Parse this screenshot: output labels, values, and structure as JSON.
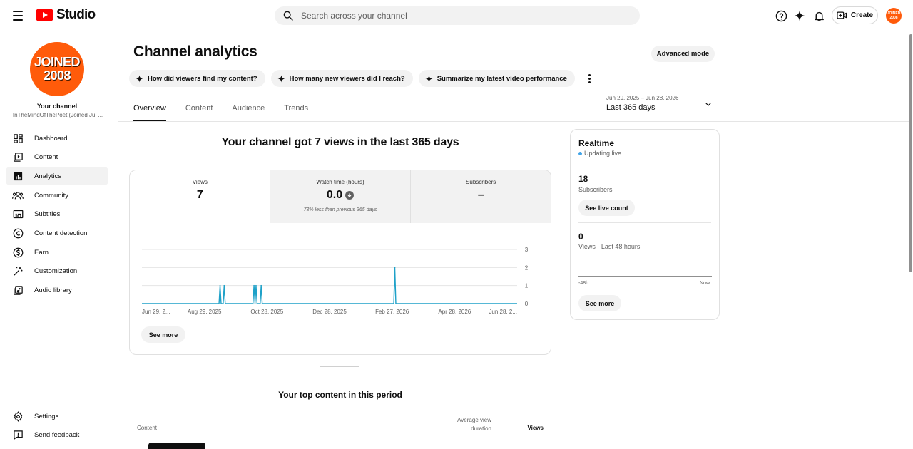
{
  "app": {
    "logo_text": "Studio",
    "search_placeholder": "Search across your channel",
    "create_label": "Create",
    "avatar_text_line1": "JOINED",
    "avatar_text_line2": "2008"
  },
  "sidebar": {
    "avatar_line1": "JOINED",
    "avatar_line2": "2008",
    "your_channel": "Your channel",
    "channel_name": "InTheMindOfThePoet (Joined Jul ...",
    "items": [
      {
        "label": "Dashboard",
        "icon": "dashboard-icon"
      },
      {
        "label": "Content",
        "icon": "content-icon"
      },
      {
        "label": "Analytics",
        "icon": "analytics-icon",
        "active": true
      },
      {
        "label": "Community",
        "icon": "community-icon"
      },
      {
        "label": "Subtitles",
        "icon": "subtitles-icon"
      },
      {
        "label": "Content detection",
        "icon": "copyright-icon"
      },
      {
        "label": "Earn",
        "icon": "dollar-icon"
      },
      {
        "label": "Customization",
        "icon": "magic-wand-icon"
      },
      {
        "label": "Audio library",
        "icon": "audio-library-icon"
      }
    ],
    "bottom_items": [
      {
        "label": "Settings",
        "icon": "gear-icon"
      },
      {
        "label": "Send feedback",
        "icon": "feedback-icon"
      }
    ]
  },
  "main": {
    "title": "Channel analytics",
    "advanced_mode": "Advanced mode",
    "chips": [
      "How did viewers find my content?",
      "How many new viewers did I reach?",
      "Summarize my latest video performance"
    ],
    "tabs": [
      "Overview",
      "Content",
      "Audience",
      "Trends"
    ],
    "active_tab": "Overview",
    "date_range": {
      "sub": "Jun 29, 2025 – Jun 28, 2026",
      "main": "Last 365 days"
    },
    "headline": "Your channel got 7 views in the last 365 days",
    "metrics": [
      {
        "label": "Views",
        "value": "7",
        "note": ""
      },
      {
        "label": "Watch time (hours)",
        "value": "0.0",
        "note": "73% less than previous 365 days"
      },
      {
        "label": "Subscribers",
        "value": "–",
        "note": ""
      }
    ],
    "see_more": "See more",
    "top_content": {
      "title": "Your top content in this period",
      "col_content": "Content",
      "col_avg_line1": "Average view",
      "col_avg_line2": "duration",
      "col_views": "Views"
    }
  },
  "chart_data": {
    "type": "line",
    "title": "",
    "xlabel": "",
    "ylabel": "",
    "ylim": [
      0,
      3
    ],
    "y_ticks": [
      "0",
      "1",
      "2",
      "3"
    ],
    "x_tick_labels": [
      "Jun 29, 2...",
      "Aug 29, 2025",
      "Oct 28, 2025",
      "Dec 28, 2025",
      "Feb 27, 2026",
      "Apr 28, 2026",
      "Jun 28, 2..."
    ],
    "x_range_days": [
      0,
      365
    ],
    "series": [
      {
        "color": "#1ea1c8",
        "points": [
          [
            76,
            1
          ],
          [
            80,
            1
          ],
          [
            109,
            1
          ],
          [
            111,
            1
          ],
          [
            116,
            1
          ],
          [
            246,
            2
          ]
        ]
      }
    ],
    "grid": true,
    "legend": "none"
  },
  "realtime": {
    "title": "Realtime",
    "status": "Updating live",
    "subscribers_value": "18",
    "subscribers_label": "Subscribers",
    "see_live_count": "See live count",
    "views_value": "0",
    "views_label": "Views · Last 48 hours",
    "axis_left": "-48h",
    "axis_right": "Now",
    "see_more": "See more",
    "live_dot_color": "#41a4e8"
  },
  "colors": {
    "brand_red": "#ff0000",
    "chart_line": "#1ea1c8",
    "avatar": "#ff5b0a"
  }
}
